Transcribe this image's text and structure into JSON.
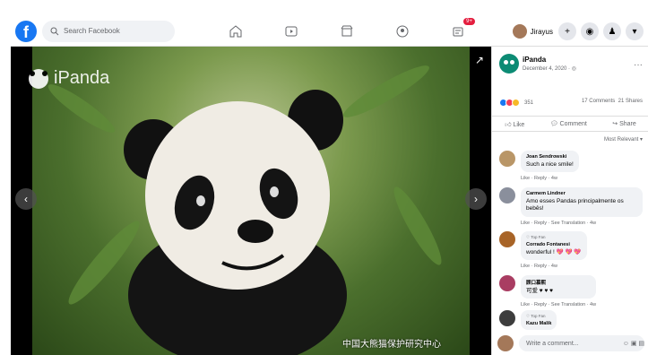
{
  "app": {
    "search_placeholder": "Search Facebook",
    "notifications_badge": "9+"
  },
  "header": {
    "user_name": "Jirayus"
  },
  "photo": {
    "watermark": "iPanda",
    "bottom_label": "中国大熊猫保护研究中心"
  },
  "post": {
    "author": "iPanda",
    "date": "December 4, 2020 · ◎",
    "reaction_count": "351",
    "comment_count": "17 Comments",
    "share_count": "21 Shares",
    "actions": [
      "Like",
      "Comment",
      "Share"
    ],
    "sort": "Most Relevant ▾"
  },
  "comments": [
    {
      "top_fan": "",
      "name": "Joan Sendrowski",
      "text": "Such a nice smile!",
      "actions": "Like · Reply · 4w"
    },
    {
      "top_fan": "",
      "name": "Carmem Lindner",
      "text": "Amo esses Pandas principalmente os bebês!",
      "actions": "Like · Reply · See Translation · 4w"
    },
    {
      "top_fan": "♡ Top Fan",
      "name": "Corrado Fontanesi",
      "text": "wonderful ! 💖 💖 💖",
      "actions": "Like · Reply · 4w"
    },
    {
      "top_fan": "",
      "name": "顾口慕熙",
      "text": "可爱 ♥ ♥ ♥",
      "actions": "Like · Reply · See Translation · 4w"
    },
    {
      "top_fan": "♡ Top Fan",
      "name": "Kazu Malik",
      "text": "",
      "actions": ""
    }
  ],
  "composer": {
    "placeholder": "Write a comment..."
  },
  "colors": {
    "facebook_blue": "#1877f2",
    "panel_bg": "#f0f2f5",
    "badge_red": "#e41e3f"
  },
  "icons": [
    "search-icon",
    "home-icon",
    "watch-icon",
    "marketplace-icon",
    "groups-icon",
    "gaming-icon",
    "plus-icon",
    "messenger-icon",
    "notifications-icon",
    "chevron-down-icon",
    "expand-icon",
    "arrow-left-icon",
    "arrow-right-icon",
    "like-icon",
    "comment-icon",
    "share-icon",
    "more-icon"
  ]
}
